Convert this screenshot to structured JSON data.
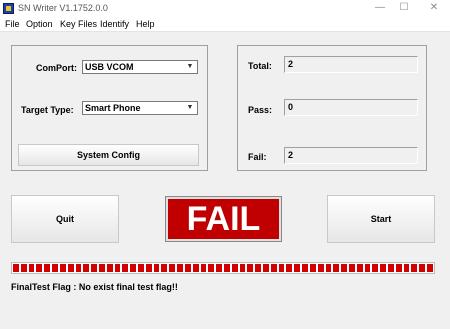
{
  "window": {
    "title": "SN Writer V1.1752.0.0",
    "minimize": "—",
    "maximize": "☐",
    "close": "✕"
  },
  "menu": [
    "File",
    "Option",
    "Key Files",
    "Identify",
    "Help"
  ],
  "config": {
    "comport_label": "ComPort:",
    "comport_value": "USB VCOM",
    "target_label": "Target Type:",
    "target_value": "Smart Phone",
    "system_config_button": "System Config"
  },
  "stats": {
    "total_label": "Total:",
    "total_value": "2",
    "pass_label": "Pass:",
    "pass_value": "0",
    "fail_label": "Fail:",
    "fail_value": "2"
  },
  "actions": {
    "quit_button": "Quit",
    "result_text": "FAIL",
    "start_button": "Start"
  },
  "progress": {
    "fraction": 1.0,
    "color": "#d40000"
  },
  "status_text": "FinalTest Flag : No exist final test flag!!"
}
